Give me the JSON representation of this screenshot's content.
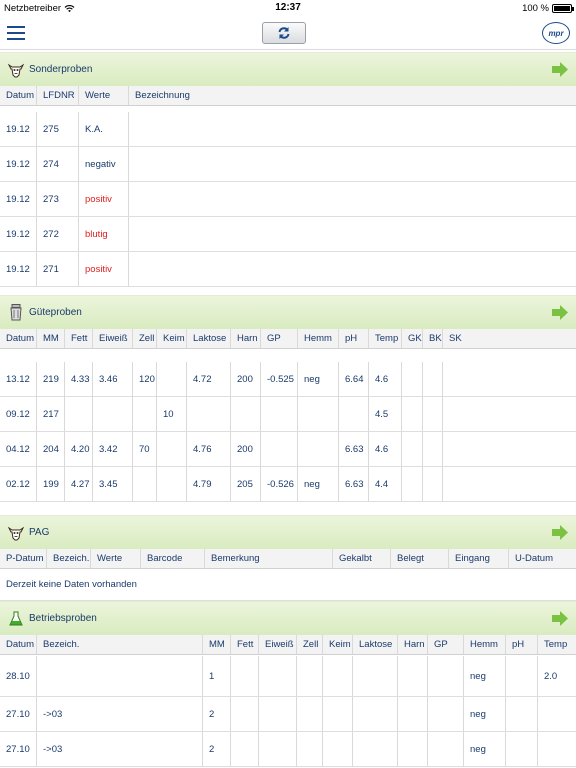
{
  "status": {
    "carrier": "Netzbetreiber",
    "time": "12:37",
    "battery": "100 %"
  },
  "app": {
    "logo": "mpr"
  },
  "sonder": {
    "title": "Sonderproben",
    "cols": [
      "Datum",
      "LFDNR",
      "Werte",
      "Bezeichnung"
    ],
    "rows": [
      {
        "datum": "19.12",
        "lfdnr": "275",
        "werte": "K.A.",
        "red": false
      },
      {
        "datum": "19.12",
        "lfdnr": "274",
        "werte": "negativ",
        "red": false
      },
      {
        "datum": "19.12",
        "lfdnr": "273",
        "werte": "positiv",
        "red": true
      },
      {
        "datum": "19.12",
        "lfdnr": "272",
        "werte": "blutig",
        "red": true
      },
      {
        "datum": "19.12",
        "lfdnr": "271",
        "werte": "positiv",
        "red": true
      }
    ]
  },
  "guete": {
    "title": "Güteproben",
    "cols": [
      "Datum",
      "MM",
      "Fett",
      "Eiweiß",
      "Zell",
      "Keim",
      "Laktose",
      "Harn",
      "GP",
      "Hemm",
      "pH",
      "Temp",
      "GK",
      "BK",
      "SK"
    ],
    "rows": [
      [
        "13.12",
        "219",
        "4.33",
        "3.46",
        "120",
        "",
        "4.72",
        "200",
        "-0.525",
        "neg",
        "6.64",
        "4.6",
        "",
        "",
        ""
      ],
      [
        "09.12",
        "217",
        "",
        "",
        "",
        "10",
        "",
        "",
        "",
        "",
        "",
        "4.5",
        "",
        "",
        ""
      ],
      [
        "04.12",
        "204",
        "4.20",
        "3.42",
        "70",
        "",
        "4.76",
        "200",
        "",
        "",
        "6.63",
        "4.6",
        "",
        "",
        ""
      ],
      [
        "02.12",
        "199",
        "4.27",
        "3.45",
        "",
        "",
        "4.79",
        "205",
        "-0.526",
        "neg",
        "6.63",
        "4.4",
        "",
        "",
        ""
      ]
    ]
  },
  "pag": {
    "title": "PAG",
    "cols": [
      "P-Datum",
      "Bezeich.",
      "Werte",
      "Barcode",
      "Bemerkung",
      "Gekalbt",
      "Belegt",
      "Eingang",
      "U-Datum"
    ],
    "empty": "Derzeit keine Daten vorhanden"
  },
  "betrieb": {
    "title": "Betriebsproben",
    "cols": [
      "Datum",
      "Bezeich.",
      "MM",
      "Fett",
      "Eiweiß",
      "Zell",
      "Keim",
      "Laktose",
      "Harn",
      "GP",
      "Hemm",
      "pH",
      "Temp"
    ],
    "rows": [
      [
        "28.10",
        "",
        "1",
        "",
        "",
        "",
        "",
        "",
        "",
        "",
        "neg",
        "",
        "2.0"
      ],
      [
        "27.10",
        "->03",
        "2",
        "",
        "",
        "",
        "",
        "",
        "",
        "",
        "neg",
        "",
        ""
      ],
      [
        "27.10",
        "->03",
        "2",
        "",
        "",
        "",
        "",
        "",
        "",
        "",
        "neg",
        "",
        ""
      ]
    ]
  },
  "colors": {
    "accent": "#1d4a8a",
    "section_bg": "#e3f0cf",
    "arrow": "#7cc242",
    "alert": "#e02020"
  },
  "icons": {
    "menu": "hamburger-icon",
    "refresh": "refresh-icon",
    "sonder": "cow-icon",
    "guete": "milk-can-icon",
    "pag": "cow-icon",
    "betrieb": "flask-icon",
    "next": "green-arrow-icon"
  }
}
